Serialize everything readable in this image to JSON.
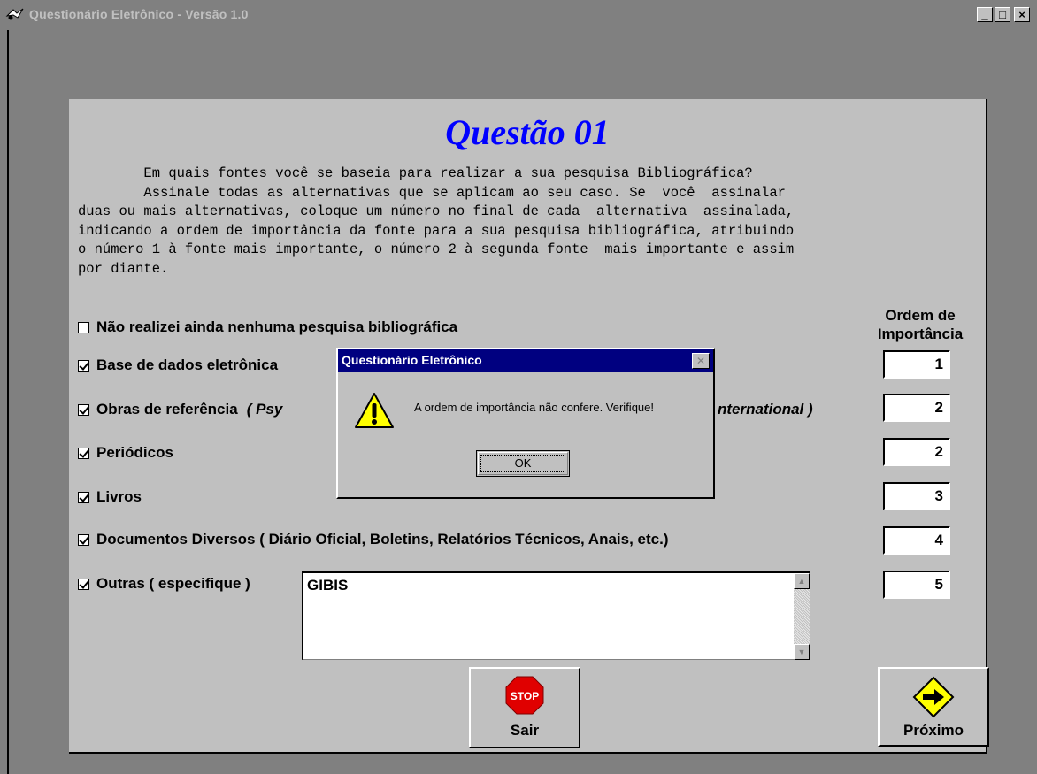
{
  "window": {
    "title": "Questionário Eletrônico - Versão 1.0",
    "controls": {
      "minimize": "_",
      "maximize": "□",
      "close": "×"
    }
  },
  "question": {
    "title": "Questão 01",
    "intro_lines": [
      "        Em quais fontes você se baseia para realizar a sua pesquisa Bibliográfica?",
      "        Assinale todas as alternativas que se aplicam ao seu caso. Se  você  assinalar",
      "duas ou mais alternativas, coloque um número no final de cada  alternativa  assinalada,",
      "indicando a ordem de importância da fonte para a sua pesquisa bibliográfica, atribuindo",
      "o número 1 à fonte mais importante, o número 2 à segunda fonte  mais importante e assim",
      "por diante."
    ]
  },
  "options": [
    {
      "label": "Não realizei ainda nenhuma pesquisa bibliográfica",
      "checked": false
    },
    {
      "label": "Base de dados eletrônica",
      "checked": true
    },
    {
      "label": "Obras de referência",
      "note_visible_left": "( Psy",
      "note_visible_right": "nternational )",
      "checked": true
    },
    {
      "label": "Periódicos",
      "checked": true
    },
    {
      "label": "Livros",
      "checked": true
    },
    {
      "label": "Documentos Diversos ( Diário Oficial, Boletins, Relatórios Técnicos, Anais, etc.)",
      "checked": true
    },
    {
      "label": "Outras ( especifique )",
      "checked": true
    }
  ],
  "order": {
    "header_line1": "Ordem de",
    "header_line2": "Importância",
    "values": [
      "1",
      "2",
      "2",
      "3",
      "4",
      "5"
    ]
  },
  "other_text": "GIBIS",
  "buttons": {
    "exit": {
      "label": "Sair",
      "icon_text": "STOP",
      "icon": "stop-sign-icon"
    },
    "next": {
      "label": "Próximo",
      "icon": "arrow-right-diamond-icon"
    }
  },
  "dialog": {
    "title": "Questionário Eletrônico",
    "message": "A ordem de importância não confere. Verifique!",
    "ok_label": "OK",
    "icon": "warning-icon"
  },
  "colors": {
    "title_blue": "#0000ff",
    "dialog_title_bg": "#000080",
    "stop_red": "#e00000",
    "next_yellow": "#ffff00"
  }
}
